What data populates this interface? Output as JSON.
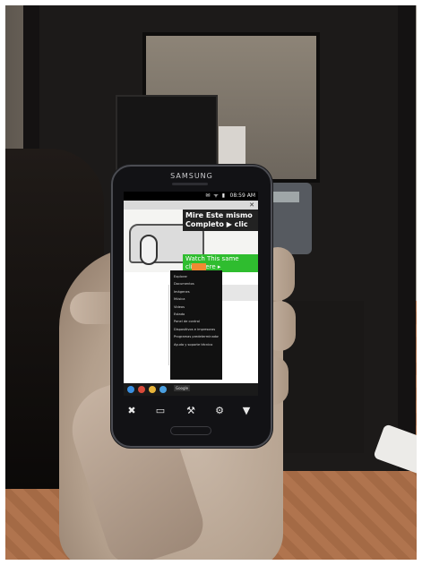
{
  "phone": {
    "brand": "SAMSUNG",
    "status_time": "08:59 AM",
    "status_icons": "✉ ᯤ ▮"
  },
  "screen": {
    "promo_dark_line1": "Mire Este mismo",
    "promo_dark_line2": "Completo ▶ clic",
    "promo_green_line1": "Watch This same",
    "promo_green_line2": "click here ▸",
    "bottom_label": "Google"
  },
  "menu": {
    "items": [
      "Explorar",
      "Documentos",
      "Imágenes",
      "Música",
      "Videos",
      "Estado",
      "Panel de control",
      "Dispositivos e impresoras",
      "Programas predeterminados",
      "Ayuda y soporte técnico"
    ]
  },
  "nav_icons": [
    "tools-icon",
    "keyboard-icon",
    "wrench-icon",
    "gear-icon",
    "down-arrow-icon"
  ]
}
